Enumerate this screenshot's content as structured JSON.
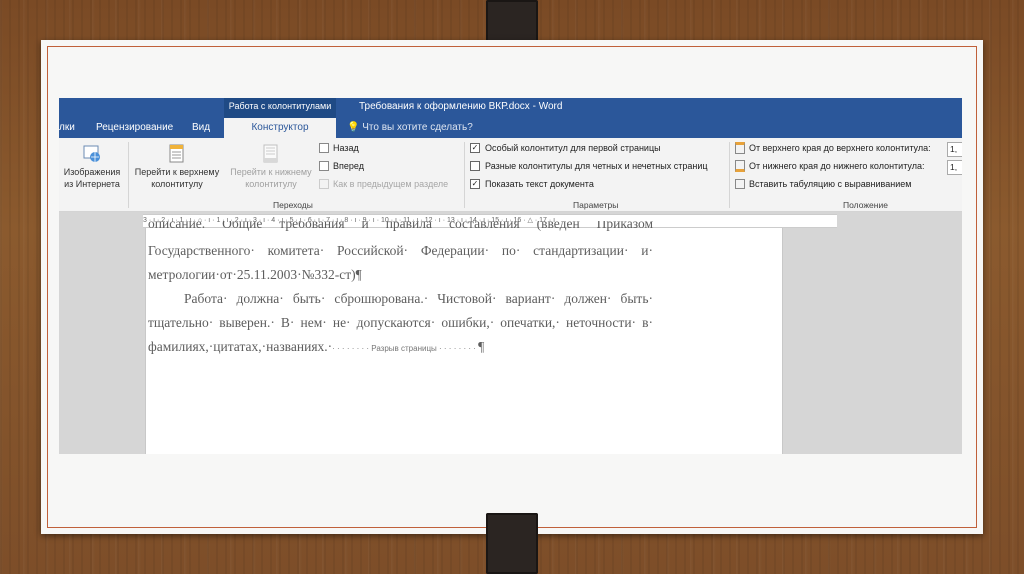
{
  "window": {
    "context_group": "Работа с колонтитулами",
    "doc_title": "Требования к оформлению ВКР.docx - Word"
  },
  "tabs": [
    {
      "label": "лки"
    },
    {
      "label": "Рецензирование"
    },
    {
      "label": "Вид"
    },
    {
      "label": "Конструктор",
      "active": true
    }
  ],
  "tellme": "Что вы хотите сделать?",
  "ribbon": {
    "insert_group": {
      "images_label": "Изображения из Интернета"
    },
    "navigation": {
      "label": "Переходы",
      "goto_header": "Перейти к верхнему колонтитулу",
      "goto_footer": "Перейти к нижнему колонтитулу",
      "back": "Назад",
      "forward": "Вперед",
      "link_previous": "Как в предыдущем разделе"
    },
    "options": {
      "label": "Параметры",
      "different_first": "Особый колонтитул для первой страницы",
      "different_first_checked": true,
      "odd_even": "Разные колонтитулы для четных и нечетных страниц",
      "odd_even_checked": false,
      "show_text": "Показать текст документа",
      "show_text_checked": true
    },
    "position": {
      "label": "Положение",
      "header_from_top": "От верхнего края до верхнего колонтитула:",
      "header_value": "1,",
      "footer_from_bottom": "От нижнего края до нижнего колонтитула:",
      "footer_value": "1,",
      "insert_tab": "Вставить табуляцию с выравниванием"
    }
  },
  "ruler": {
    "text": "3 · ı · 2 · ı · 1 · ı · ⌂ · ı · 1 · ı · 2 · ı · 3 · ı · 4 · ı · 5 · ı · 6 · ı · 7 · ı · 8 · ı · 9 · ı · 10 · ı · 11 · ı · 12 · ı · 13 · ı · 14 · ı · 15 · ı · 16 · △ · 17 · ı"
  },
  "document": {
    "line0": "описание. Общие требования и правила составления (введен Приказом",
    "line1": "Государственного· комитета· Российской· Федерации· по· стандартизации· и·",
    "line2": "метрологии·от·25.11.2003·№332-ст)¶",
    "line3": "Работа· должна· быть· сброшюрована.· Чистовой· вариант· должен· быть·",
    "line4": "тщательно· выверен.· В· нем· не· допускаются· ошибки,· опечатки,· неточности· в·",
    "line5": "фамилиях,·цитатах,·названиях.·",
    "page_break": "Разрыв страницы",
    "pilcrow": "¶"
  }
}
